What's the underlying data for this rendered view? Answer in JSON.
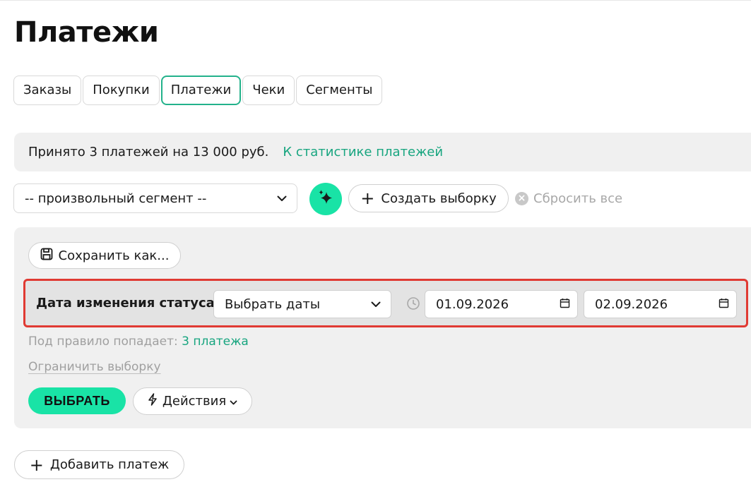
{
  "page": {
    "title": "Платежи"
  },
  "tabs": [
    {
      "label": "Заказы"
    },
    {
      "label": "Покупки"
    },
    {
      "label": "Платежи",
      "active": true
    },
    {
      "label": "Чеки"
    },
    {
      "label": "Сегменты"
    }
  ],
  "info": {
    "summary": "Принято 3 платежей на 13 000 руб.",
    "stats_link": "К статистике платежей"
  },
  "segment": {
    "selected": "-- произвольный сегмент --",
    "create_label": "Создать выборку",
    "reset_label": "Сбросить все"
  },
  "filter": {
    "save_as_label": "Сохранить как...",
    "rule": {
      "label": "Дата изменения статуса",
      "mode": "Выбрать даты",
      "date_from": "01.09.2026",
      "date_to": "02.09.2026"
    },
    "rule_count_prefix": "Под правило попадает:",
    "rule_count_value": "3 платежа",
    "limit_link": "Ограничить выборку",
    "select_button": "ВЫБРАТЬ",
    "actions_label": "Действия"
  },
  "add_payment_label": "Добавить платеж",
  "colors": {
    "accent": "#19e3a6",
    "link": "#17a57f",
    "highlight_border": "#e03a33",
    "panel_bg": "#f0f0f0"
  },
  "icons": {
    "magic": "sparkle-icon",
    "save": "floppy-disk-icon",
    "clock": "clock-icon",
    "calendar": "calendar-icon",
    "actions": "lightning-icon"
  }
}
